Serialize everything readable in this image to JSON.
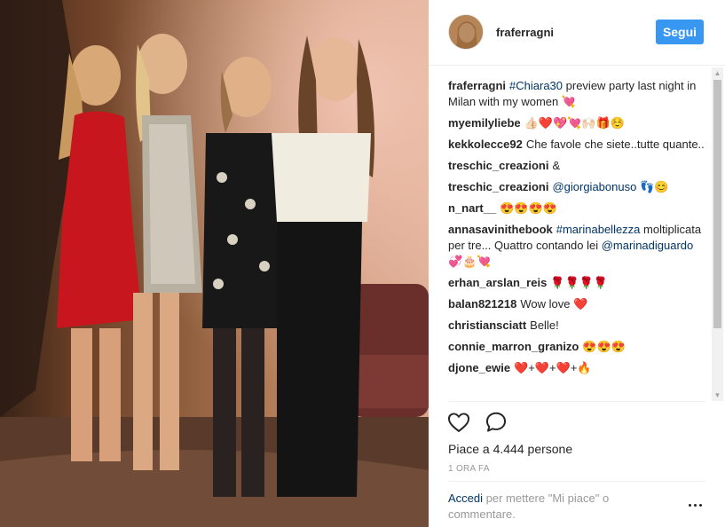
{
  "header": {
    "username": "fraferragni",
    "follow_label": "Segui"
  },
  "comments": [
    {
      "user": "fraferragni",
      "parts": [
        {
          "t": "tag",
          "v": "#Chiara30"
        },
        {
          "t": "text",
          "v": " preview party last night in Milan with my women 💘"
        }
      ]
    },
    {
      "user": "myemilyliebe",
      "parts": [
        {
          "t": "text",
          "v": "👍🏻❤️💖💘🙌🏻🎁☺️"
        }
      ]
    },
    {
      "user": "kekkolecce92",
      "parts": [
        {
          "t": "text",
          "v": "Che favole che siete..tutte quante.."
        }
      ]
    },
    {
      "user": "treschic_creazioni",
      "parts": [
        {
          "t": "text",
          "v": "&"
        }
      ]
    },
    {
      "user": "treschic_creazioni",
      "parts": [
        {
          "t": "tag",
          "v": "@giorgiabonuso"
        },
        {
          "t": "text",
          "v": " 👣😊"
        }
      ]
    },
    {
      "user": "n_nart__",
      "parts": [
        {
          "t": "text",
          "v": "😍😍😍😍"
        }
      ]
    },
    {
      "user": "annasavinithebook",
      "parts": [
        {
          "t": "tag",
          "v": "#marinabellezza"
        },
        {
          "t": "text",
          "v": " moltiplicata per tre... Quattro contando lei "
        },
        {
          "t": "tag",
          "v": "@marinadiguardo"
        },
        {
          "t": "text",
          "v": " 💞🎂💘"
        }
      ]
    },
    {
      "user": "erhan_arslan_reis",
      "parts": [
        {
          "t": "text",
          "v": "🌹🌹🌹🌹"
        }
      ]
    },
    {
      "user": "balan821218",
      "parts": [
        {
          "t": "text",
          "v": "Wow love ❤️"
        }
      ]
    },
    {
      "user": "christiansciatt",
      "parts": [
        {
          "t": "text",
          "v": "Belle!"
        }
      ]
    },
    {
      "user": "connie_marron_granizo",
      "parts": [
        {
          "t": "text",
          "v": "😍😍😍"
        }
      ]
    },
    {
      "user": "djone_ewie",
      "parts": [
        {
          "t": "text",
          "v": "❤️+❤️+❤️+🔥"
        }
      ]
    }
  ],
  "likes": {
    "prefix": "Piace a ",
    "count": "4.444",
    "suffix": " persone"
  },
  "timestamp": "1 ORA FA",
  "login": {
    "link": "Accedi",
    "rest": " per mettere \"Mi piace\" o commentare."
  },
  "icons": {
    "like": "heart-outline-icon",
    "comment": "speech-bubble-icon",
    "more": "more-options-icon"
  },
  "colors": {
    "follow": "#3897f0",
    "link": "#003569",
    "muted": "#999999"
  }
}
